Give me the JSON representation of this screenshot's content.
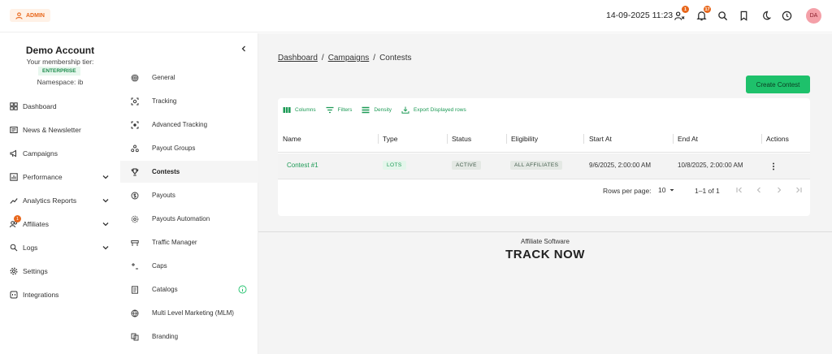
{
  "header": {
    "role_badge": "ADMIN",
    "datetime": "14-09-2025 11:23",
    "user_badge_count": "1",
    "notification_count": "17",
    "avatar_initials": "DA"
  },
  "account": {
    "name": "Demo Account",
    "tier_label": "Your membership tier:",
    "tier": "ENTERPRISE",
    "namespace": "Namespace: ib"
  },
  "sidebar": {
    "items": [
      {
        "label": "Dashboard",
        "icon": "dashboard-icon"
      },
      {
        "label": "News & Newsletter",
        "icon": "newspaper-icon"
      },
      {
        "label": "Campaigns",
        "icon": "megaphone-icon"
      },
      {
        "label": "Performance",
        "icon": "chart-icon"
      },
      {
        "label": "Analytics Reports",
        "icon": "trend-icon"
      },
      {
        "label": "Affiliates",
        "icon": "people-icon",
        "badge": "1"
      },
      {
        "label": "Logs",
        "icon": "search-doc-icon"
      },
      {
        "label": "Settings",
        "icon": "gear-icon"
      },
      {
        "label": "Integrations",
        "icon": "plug-icon"
      }
    ]
  },
  "submenu": {
    "items": [
      {
        "label": "General"
      },
      {
        "label": "Tracking"
      },
      {
        "label": "Advanced Tracking"
      },
      {
        "label": "Payout Groups"
      },
      {
        "label": "Contests"
      },
      {
        "label": "Payouts"
      },
      {
        "label": "Payouts Automation"
      },
      {
        "label": "Traffic Manager"
      },
      {
        "label": "Caps"
      },
      {
        "label": "Catalogs"
      },
      {
        "label": "Multi Level Marketing (MLM)"
      },
      {
        "label": "Branding"
      }
    ]
  },
  "breadcrumb": {
    "dashboard": "Dashboard",
    "campaigns": "Campaigns",
    "current": "Contests",
    "sep": "/"
  },
  "main": {
    "create_button": "Create Contest",
    "toolbar": {
      "columns": "Columns",
      "filters": "Filters",
      "density": "Density",
      "export": "Export Displayed rows"
    },
    "table": {
      "headers": [
        "Name",
        "Type",
        "Status",
        "Eligibility",
        "Start At",
        "End At",
        "Actions"
      ],
      "rows": [
        {
          "name": "Contest #1",
          "type": "LOTS",
          "status": "ACTIVE",
          "eligibility": "ALL AFFILIATES",
          "start_at": "9/6/2025, 2:00:00 AM",
          "end_at": "10/8/2025, 2:00:00 AM"
        }
      ]
    },
    "pager": {
      "rows_per_page_label": "Rows per page:",
      "rows_per_page": "10",
      "range": "1–1 of 1"
    }
  },
  "footer": {
    "tagline": "Affiliate Software",
    "logo": "TRACK NOW"
  },
  "colors": {
    "accent_green": "#1ec16b",
    "accent_orange": "#e8671c"
  }
}
